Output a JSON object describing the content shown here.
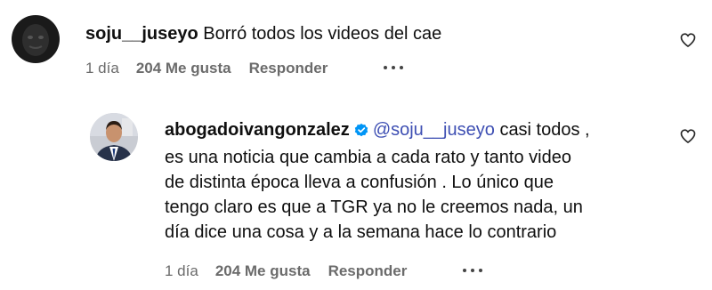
{
  "comment1": {
    "username": "soju__juseyo",
    "text": "Borró todos los videos del cae",
    "time": "1 día",
    "likes": "204 Me gusta",
    "reply": "Responder"
  },
  "comment2": {
    "username": "abogadoivangonzalez",
    "mention": "@soju__juseyo",
    "line1_rest": "casi todos ,",
    "lines": [
      "es una noticia que cambia a cada rato y tanto video",
      "de distinta época lleva a confusión . Lo único que",
      "tengo claro es que a TGR ya no le creemos nada, un",
      "día dice una cosa y a la semana hace lo contrario"
    ],
    "time": "1 día",
    "likes": "204 Me gusta",
    "reply": "Responder"
  },
  "icons": {
    "like": "heart-icon",
    "verified": "verified-badge-icon",
    "more": "more-options-icon"
  },
  "colors": {
    "mention": "#3e4fb3",
    "verified": "#0095f6",
    "meta": "#6b6b6b"
  }
}
